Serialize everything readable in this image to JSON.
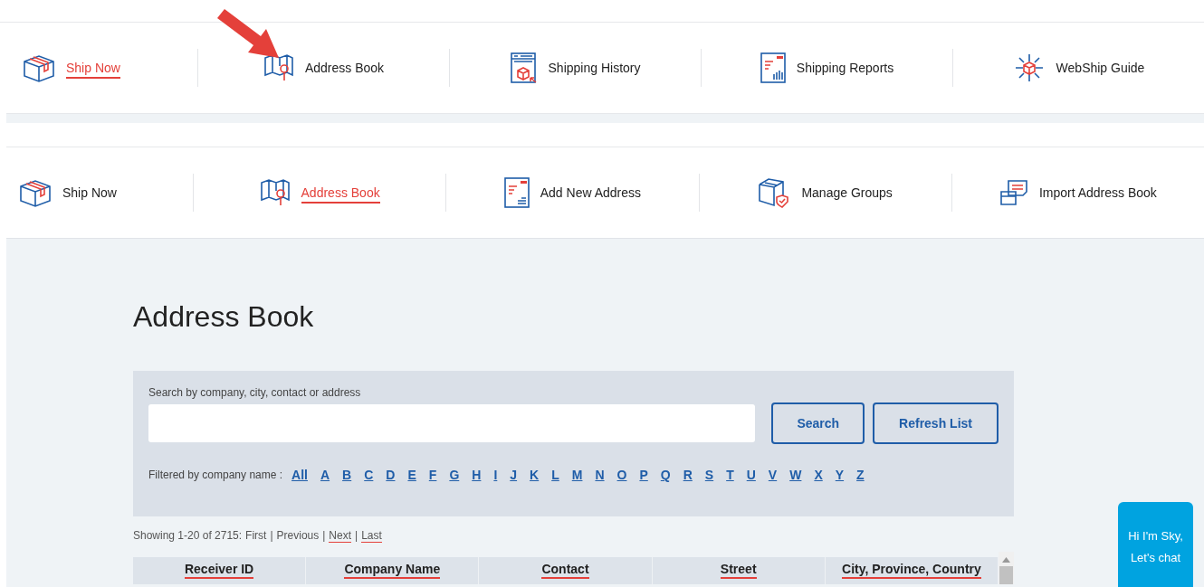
{
  "top_nav": [
    {
      "label": "Ship Now",
      "selected": true
    },
    {
      "label": "Address Book",
      "selected": false
    },
    {
      "label": "Shipping History",
      "selected": false
    },
    {
      "label": "Shipping Reports",
      "selected": false
    },
    {
      "label": "WebShip Guide",
      "selected": false
    }
  ],
  "sub_nav": [
    {
      "label": "Ship Now",
      "selected": false
    },
    {
      "label": "Address Book",
      "selected": true
    },
    {
      "label": "Add New Address",
      "selected": false
    },
    {
      "label": "Manage Groups",
      "selected": false
    },
    {
      "label": "Import Address Book",
      "selected": false
    }
  ],
  "heading": "Address Book",
  "search": {
    "label": "Search by company, city, contact or address",
    "buttons": [
      "Search",
      "Refresh List"
    ]
  },
  "filter": {
    "label": "Filtered by company name :",
    "letters": [
      "All",
      "A",
      "B",
      "C",
      "D",
      "E",
      "F",
      "G",
      "H",
      "I",
      "J",
      "K",
      "L",
      "M",
      "N",
      "O",
      "P",
      "Q",
      "R",
      "S",
      "T",
      "U",
      "V",
      "W",
      "X",
      "Y",
      "Z"
    ]
  },
  "pagination": {
    "prefix": "Showing 1-20 of 2715:",
    "separator": "|",
    "items": [
      {
        "label": "First",
        "link": false
      },
      {
        "label": "Previous",
        "link": false
      },
      {
        "label": "Next",
        "link": true
      },
      {
        "label": "Last",
        "link": true
      }
    ]
  },
  "table": {
    "columns": [
      "Receiver ID",
      "Company Name",
      "Contact",
      "Street",
      "City, Province, Country"
    ]
  },
  "chat": {
    "label": "Hi I'm Sky, Let's chat"
  }
}
